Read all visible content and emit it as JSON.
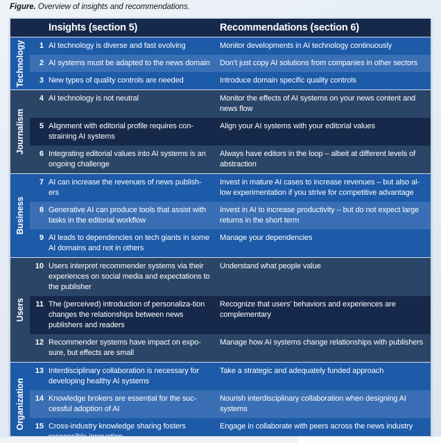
{
  "caption": {
    "label": "Figure.",
    "text": " Overview of insights and recommendations."
  },
  "colors": {
    "page_background": "#e9eff5",
    "header_background": "#16294a",
    "band_blue": "#1d5aa8",
    "band_blue_alt": "#3a6fb5",
    "band_slate": "#2b4567",
    "band_slate_alt": "#16294a",
    "text": "#ffffff",
    "table_border": "#d3e0ec"
  },
  "table": {
    "header": {
      "insights": "Insights (section 5)",
      "recommendations": "Recommendations (section 6)"
    },
    "groups": [
      {
        "category": "Technology",
        "palette": "blue",
        "rows": [
          {
            "num": "1",
            "insight": "AI technology is diverse and fast evolving",
            "recommendation": "Monitor developments in AI technology continuously"
          },
          {
            "num": "2",
            "insight": "AI systems must be adapted to the news domain",
            "recommendation": "Don’t just copy AI solutions from companies in other sectors"
          },
          {
            "num": "3",
            "insight": "New types of quality controls are needed",
            "recommendation": "Introduce domain specific quality controls"
          }
        ]
      },
      {
        "category": "Journalism",
        "palette": "slate",
        "rows": [
          {
            "num": "4",
            "insight": "AI technology is not neutral",
            "recommendation": "Monitor the effects of AI systems on your news content and news flow"
          },
          {
            "num": "5",
            "insight": "Alignment with editorial profile requires con-straining AI systems",
            "recommendation": "Align your AI systems with your editorial values"
          },
          {
            "num": "6",
            "insight": "Integrating editorial values into AI systems is an ongoing challenge",
            "recommendation": "Always have editors in the loop – albeit at different levels of abstraction"
          }
        ]
      },
      {
        "category": "Business",
        "palette": "blue",
        "rows": [
          {
            "num": "7",
            "insight": "AI can increase the revenues of news publish-ers",
            "recommendation": "Invest in mature AI cases to increase revenues – but also al-low experimentation if you strive for competitive advantage"
          },
          {
            "num": "8",
            "insight": "Generative AI can produce tools that assist with tasks in the editorial workflow",
            "recommendation": "Invest in AI to increase productivity – but do not expect large returns in the short term"
          },
          {
            "num": "9",
            "insight": "AI leads to dependencies on tech giants in some AI domains and not in others",
            "recommendation": " Manage your dependencies"
          }
        ]
      },
      {
        "category": "Users",
        "palette": "slate",
        "rows": [
          {
            "num": "10",
            "insight": "Users interpret recommender systems via their experiences on social media and expectations to the publisher",
            "recommendation": "Understand what people value"
          },
          {
            "num": "11",
            "insight": "The (perceived) introduction of personaliza-tion changes the relationships between news publishers and readers",
            "recommendation": "Recognize that users’ behaviors and experiences are complementary"
          },
          {
            "num": "12",
            "insight": "Recommender systems have impact on expo-sure, but effects are small",
            "recommendation": "Manage how AI systems change relationships with publishers"
          }
        ]
      },
      {
        "category": "Organization",
        "palette": "blue",
        "rows": [
          {
            "num": "13",
            "insight": "Interdisciplinary collaboration is necessary for developing healthy AI systems",
            "recommendation": "Take a strategic and adequately funded approach"
          },
          {
            "num": "14",
            "insight": "Knowledge brokers are essential for the suc-cessful adoption of AI",
            "recommendation": "Nourish interdisciplinary collaboration when designing AI systems"
          },
          {
            "num": "15",
            "insight": "Cross-industry knowledge sharing fosters responsible innovation",
            "recommendation": "Engage in collaborate with peers across the news industry"
          }
        ]
      }
    ]
  }
}
